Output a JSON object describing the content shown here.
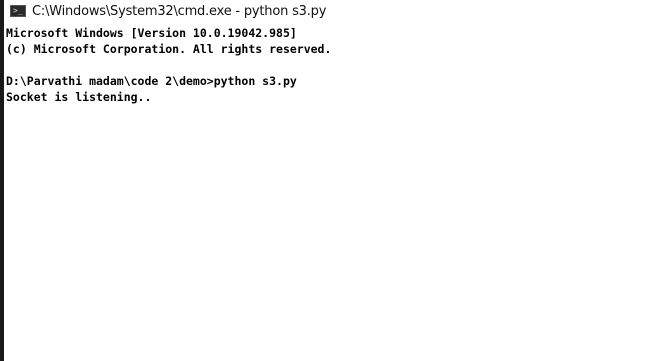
{
  "window": {
    "title": "C:\\Windows\\System32\\cmd.exe - python  s3.py",
    "icon": "cmd-console-icon",
    "icon_glyph": ">_"
  },
  "console": {
    "lines": [
      "Microsoft Windows [Version 10.0.19042.985]",
      "(c) Microsoft Corporation. All rights reserved.",
      "",
      "D:\\Parvathi madam\\code 2\\demo>python s3.py",
      "Socket is listening.."
    ]
  },
  "colors": {
    "background": "#ffffff",
    "text": "#000000",
    "left_border": "#1a1a1a"
  }
}
